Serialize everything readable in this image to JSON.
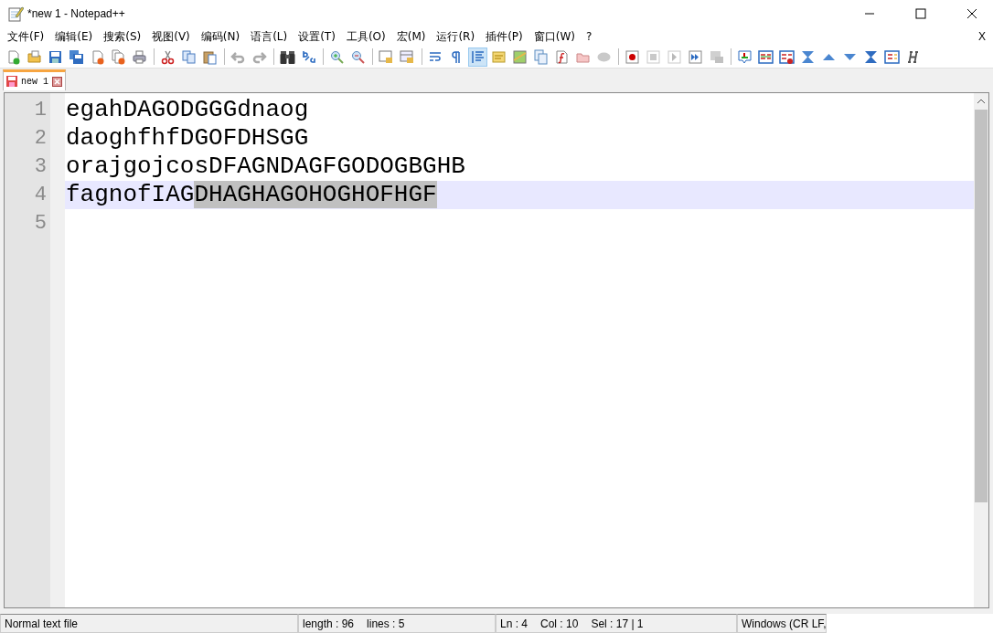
{
  "window": {
    "title": "*new 1 - Notepad++"
  },
  "menu": [
    "文件(F)",
    "编辑(E)",
    "搜索(S)",
    "视图(V)",
    "编码(N)",
    "语言(L)",
    "设置(T)",
    "工具(O)",
    "宏(M)",
    "运行(R)",
    "插件(P)",
    "窗口(W)",
    "?"
  ],
  "menu_close": "X",
  "toolbar": [
    [
      {
        "kind": "new",
        "disabled": false,
        "selected": false
      },
      {
        "kind": "open",
        "disabled": false,
        "selected": false
      },
      {
        "kind": "save",
        "disabled": false,
        "selected": false
      },
      {
        "kind": "saveall",
        "disabled": false,
        "selected": false
      },
      {
        "kind": "close",
        "disabled": false,
        "selected": false
      },
      {
        "kind": "closeall",
        "disabled": false,
        "selected": false
      },
      {
        "kind": "print",
        "disabled": false,
        "selected": false
      }
    ],
    [
      {
        "kind": "cut",
        "disabled": false,
        "selected": false
      },
      {
        "kind": "copy",
        "disabled": false,
        "selected": false
      },
      {
        "kind": "paste",
        "disabled": false,
        "selected": false
      }
    ],
    [
      {
        "kind": "undo",
        "disabled": true,
        "selected": false
      },
      {
        "kind": "redo",
        "disabled": true,
        "selected": false
      }
    ],
    [
      {
        "kind": "find",
        "disabled": false,
        "selected": false
      },
      {
        "kind": "replace",
        "disabled": false,
        "selected": false
      }
    ],
    [
      {
        "kind": "zoomin",
        "disabled": false,
        "selected": false
      },
      {
        "kind": "zoomout",
        "disabled": false,
        "selected": false
      }
    ],
    [
      {
        "kind": "syncv",
        "disabled": false,
        "selected": false
      },
      {
        "kind": "synch",
        "disabled": false,
        "selected": false
      }
    ],
    [
      {
        "kind": "wrap",
        "disabled": false,
        "selected": false
      },
      {
        "kind": "pilcrow",
        "disabled": false,
        "selected": false
      },
      {
        "kind": "indent",
        "disabled": false,
        "selected": true
      },
      {
        "kind": "udl",
        "disabled": false,
        "selected": false
      },
      {
        "kind": "map",
        "disabled": false,
        "selected": false
      },
      {
        "kind": "docs",
        "disabled": false,
        "selected": false
      },
      {
        "kind": "func",
        "disabled": false,
        "selected": false
      },
      {
        "kind": "folder",
        "disabled": false,
        "selected": false
      },
      {
        "kind": "monitor",
        "disabled": true,
        "selected": false
      }
    ],
    [
      {
        "kind": "record",
        "disabled": false,
        "selected": false
      },
      {
        "kind": "stop",
        "disabled": true,
        "selected": false
      },
      {
        "kind": "play",
        "disabled": true,
        "selected": false
      },
      {
        "kind": "playmulti",
        "disabled": false,
        "selected": false
      },
      {
        "kind": "savemacro",
        "disabled": true,
        "selected": false
      }
    ],
    [
      {
        "kind": "bookmark",
        "disabled": false,
        "selected": false
      },
      {
        "kind": "list",
        "disabled": false,
        "selected": false
      },
      {
        "kind": "listdel",
        "disabled": false,
        "selected": false
      },
      {
        "kind": "first",
        "disabled": false,
        "selected": false
      },
      {
        "kind": "up",
        "disabled": false,
        "selected": false
      },
      {
        "kind": "down",
        "disabled": false,
        "selected": false
      },
      {
        "kind": "last",
        "disabled": false,
        "selected": false
      },
      {
        "kind": "panel",
        "disabled": false,
        "selected": false
      },
      {
        "kind": "heading",
        "disabled": false,
        "selected": false
      }
    ]
  ],
  "tabs": [
    {
      "label": "new 1",
      "selected": true,
      "modified": true
    }
  ],
  "lines": [
    {
      "number": "1",
      "text": "egahDAGODGGGdnaog",
      "current": false
    },
    {
      "number": "2",
      "text": "daoghfhfDGOFDHSGG",
      "current": false
    },
    {
      "number": "3",
      "text": "orajgojcosDFAGNDAGFGODOGBGHB",
      "current": false
    },
    {
      "number": "4",
      "text": "fagnofIAG",
      "selection": "DHAGHAGOHOGHOFHGF",
      "current": true
    },
    {
      "number": "5",
      "current": false
    }
  ],
  "status_bar": {
    "file_type": "Normal text file",
    "length": "length : 96",
    "lines": "lines : 5",
    "ln": "Ln : 4",
    "col": "Col : 10",
    "sel": "Sel : 17 | 1",
    "eol": "Windows (CR LF,"
  }
}
